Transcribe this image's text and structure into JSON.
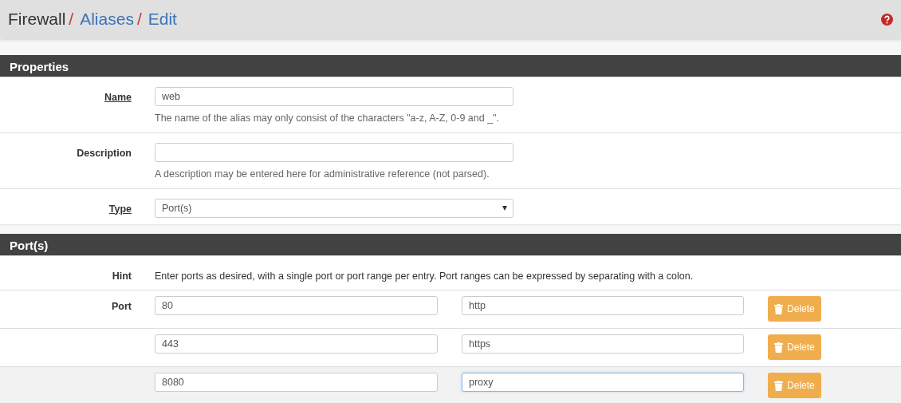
{
  "breadcrumb": [
    {
      "label": "Firewall",
      "link": false
    },
    {
      "separator": "/",
      "label": "Aliases",
      "link": true
    },
    {
      "separator": "/",
      "label": "Edit",
      "link": true
    }
  ],
  "properties": {
    "title": "Properties",
    "fields": [
      {
        "kind": "text",
        "label": "Name",
        "required": true,
        "value": "web",
        "help": "The name of the alias may only consist of the characters \"a-z, A-Z, 0-9 and _\"."
      },
      {
        "kind": "text",
        "label": "Description",
        "required": false,
        "help": "A description may be entered here for administrative reference (not parsed)."
      },
      {
        "kind": "select",
        "label": "Type",
        "required": true,
        "value": "Port(s)"
      }
    ]
  },
  "ports": {
    "title": "Port(s)",
    "hint_label": "Hint",
    "hint": "Enter ports as desired, with a single port or port range per entry. Port ranges can be expressed by separating with a colon.",
    "port_label": "Port",
    "rows": [
      {
        "port": "80",
        "description": "http",
        "focused": false,
        "hovered": false,
        "button": "Delete"
      },
      {
        "port": "443",
        "description": "https",
        "focused": false,
        "hovered": false,
        "button": "Delete"
      },
      {
        "port": "8080",
        "description": "proxy",
        "focused": true,
        "hovered": true,
        "button": "Delete"
      }
    ]
  }
}
